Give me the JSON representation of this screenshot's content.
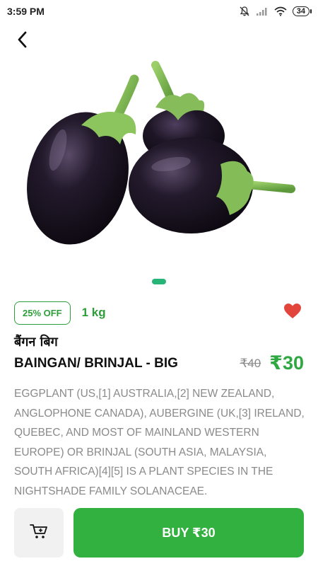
{
  "status_bar": {
    "time": "3:59 PM",
    "battery": "34",
    "icons": [
      "mute-bell-icon",
      "signal-icon",
      "wifi-icon",
      "battery-icon"
    ]
  },
  "navigation": {
    "back_icon": "chevron-left-icon"
  },
  "product": {
    "image_alt": "eggplant-image",
    "pager": {
      "pages": 1,
      "active_index": 0
    },
    "discount_badge": "25% OFF",
    "weight": "1 kg",
    "favorite": {
      "icon": "heart-icon",
      "active": true,
      "color": "#e2453c"
    },
    "name_hindi": "बैंगन बिग",
    "name": "BAINGAN/ BRINJAL - BIG",
    "old_price": "₹40",
    "price": "₹30",
    "description": "Eggplant (US,[1] Australia,[2] New Zealand, Anglophone Canada), aubergine (UK,[3] Ireland, Quebec, and most of mainland Western Europe) or brinjal (South Asia, Malaysia, South Africa)[4][5] is a plant species in the nightshade family Solanaceae."
  },
  "actions": {
    "cart_icon": "cart-icon",
    "buy_label": "BUY ₹30"
  },
  "colors": {
    "accent_green": "#33b140",
    "pager_green": "#27b478",
    "heart_red": "#e2453c"
  }
}
